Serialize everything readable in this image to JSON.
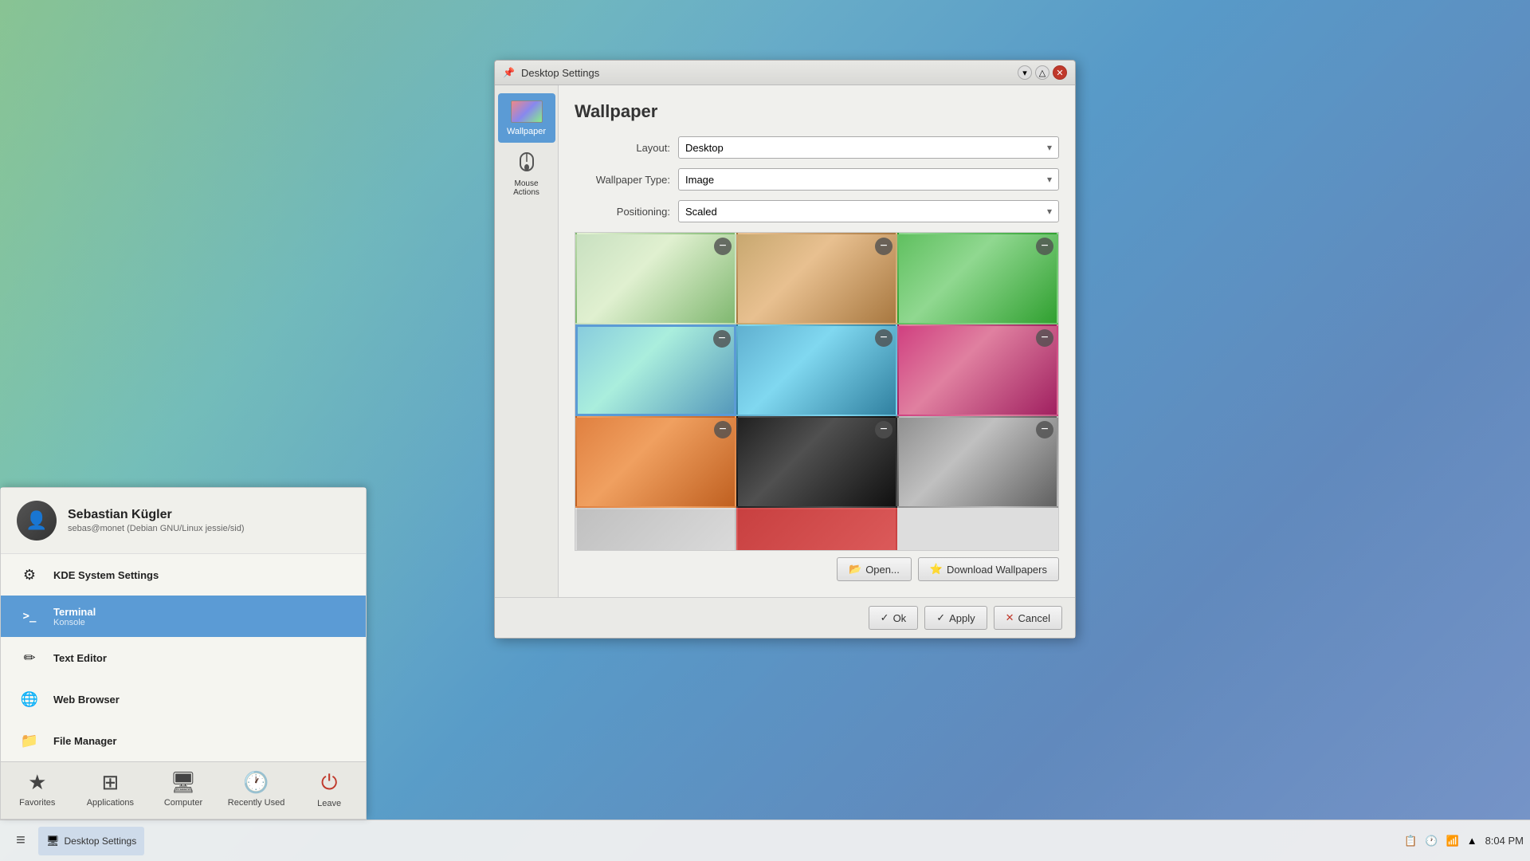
{
  "desktop": {
    "title": "Desktop"
  },
  "taskbar": {
    "app_btn_label": "≡",
    "window_label": "Desktop Settings",
    "time": "8:04 PM"
  },
  "app_menu": {
    "user": {
      "name": "Sebastian Kügler",
      "email": "sebas@monet (Debian GNU/Linux jessie/sid)",
      "avatar_char": "👤"
    },
    "items": [
      {
        "id": "kde-settings",
        "label": "KDE System Settings",
        "sublabel": "",
        "icon": "⚙"
      },
      {
        "id": "terminal",
        "label": "Terminal",
        "sublabel": "Konsole",
        "icon": ">_",
        "active": true
      },
      {
        "id": "text-editor",
        "label": "Text Editor",
        "sublabel": "",
        "icon": "✏"
      },
      {
        "id": "web-browser",
        "label": "Web Browser",
        "sublabel": "",
        "icon": "🌐"
      },
      {
        "id": "file-manager",
        "label": "File Manager",
        "sublabel": "",
        "icon": "📁"
      }
    ],
    "footer": [
      {
        "id": "favorites",
        "label": "Favorites",
        "icon": "★",
        "active": false
      },
      {
        "id": "applications",
        "label": "Applications",
        "icon": "⊞",
        "active": false
      },
      {
        "id": "computer",
        "label": "Computer",
        "icon": "🖥",
        "active": false
      },
      {
        "id": "recently-used",
        "label": "Recently Used",
        "icon": "🕐",
        "active": false
      },
      {
        "id": "leave",
        "label": "Leave",
        "icon": "⏻",
        "active": false
      }
    ]
  },
  "desktop_settings": {
    "window_title": "Desktop Settings",
    "sidebar_items": [
      {
        "id": "wallpaper",
        "label": "Wallpaper",
        "icon": "wallpaper",
        "active": true
      },
      {
        "id": "mouse-actions",
        "label": "Mouse Actions",
        "icon": "mouse",
        "active": false
      }
    ],
    "main_title": "Wallpaper",
    "fields": {
      "layout_label": "Layout:",
      "layout_value": "Desktop",
      "wallpaper_type_label": "Wallpaper Type:",
      "wallpaper_type_value": "Image",
      "positioning_label": "Positioning:",
      "positioning_value": "Scaled"
    },
    "wallpapers": [
      {
        "id": 1,
        "style": "thumb-1",
        "selected": false
      },
      {
        "id": 2,
        "style": "thumb-2",
        "selected": false
      },
      {
        "id": 3,
        "style": "thumb-3",
        "selected": false
      },
      {
        "id": 4,
        "style": "thumb-4",
        "selected": true
      },
      {
        "id": 5,
        "style": "thumb-5",
        "selected": false
      },
      {
        "id": 6,
        "style": "thumb-6",
        "selected": false
      },
      {
        "id": 7,
        "style": "thumb-7",
        "selected": false
      },
      {
        "id": 8,
        "style": "thumb-8",
        "selected": false
      },
      {
        "id": 9,
        "style": "thumb-9",
        "selected": false
      }
    ],
    "buttons": {
      "open": "Open...",
      "download": "Download Wallpapers",
      "ok": "Ok",
      "apply": "Apply",
      "cancel": "Cancel"
    }
  }
}
